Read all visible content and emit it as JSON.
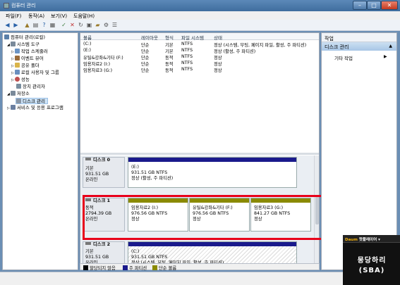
{
  "window": {
    "title": "컴퓨터 관리"
  },
  "menu": [
    "파일(F)",
    "동작(A)",
    "보기(V)",
    "도움말(H)"
  ],
  "tree": {
    "items": [
      {
        "label": "컴퓨터 관리(로컬)",
        "icon": "computer-icon",
        "color": "#5a7fa8"
      },
      {
        "label": "시스템 도구",
        "icon": "tools-icon",
        "color": "#7a8a9a"
      },
      {
        "label": "작업 스케줄러",
        "icon": "clock-icon",
        "color": "#6b94c4"
      },
      {
        "label": "이벤트 뷰어",
        "icon": "event-icon",
        "color": "#9a6b3a"
      },
      {
        "label": "공유 폴더",
        "icon": "folder-icon",
        "color": "#d9b44a"
      },
      {
        "label": "로컬 사용자 및 그룹",
        "icon": "users-icon",
        "color": "#6a8fbf"
      },
      {
        "label": "성능",
        "icon": "performance-icon",
        "color": "#c05050"
      },
      {
        "label": "장치 관리자",
        "icon": "device-icon",
        "color": "#7a8fa0"
      },
      {
        "label": "저장소",
        "icon": "storage-icon",
        "color": "#7a8a9a"
      },
      {
        "label": "디스크 관리",
        "icon": "disk-icon",
        "color": "#8895a5"
      },
      {
        "label": "서비스 및 응용 프로그램",
        "icon": "services-icon",
        "color": "#6a7fa0"
      }
    ]
  },
  "volumes": {
    "headers": [
      "볼륨",
      "레이아웃",
      "형식",
      "파일 시스템",
      "상태"
    ],
    "rows": [
      [
        "(C:)",
        "단순",
        "기본",
        "NTFS",
        "정상 (시스템, 부팅, 페이지 파일, 활성, 주 파티션)"
      ],
      [
        "(E:)",
        "단순",
        "기본",
        "NTFS",
        "정상 (활성, 주 파티션)"
      ],
      [
        "유틸&강좌&기타 (F:)",
        "단순",
        "동적",
        "NTFS",
        "정상"
      ],
      [
        "임용자료2 (I:)",
        "단순",
        "동적",
        "NTFS",
        "정상"
      ],
      [
        "임용자료3 (G:)",
        "단순",
        "동적",
        "NTFS",
        "정상"
      ]
    ]
  },
  "disks": [
    {
      "name": "디스크 0",
      "type": "기본",
      "size": "931.51 GB",
      "status": "온라인",
      "partitions": [
        {
          "label": "(E:)",
          "detail": "931.51 GB NTFS",
          "status": "정상 (활성, 주 파티션)"
        }
      ]
    },
    {
      "name": "디스크 1",
      "type": "동적",
      "size": "2794.39 GB",
      "status": "온라인",
      "partitions": [
        {
          "label": "임용자료2  (I:)",
          "detail": "976.56 GB NTFS",
          "status": "정상"
        },
        {
          "label": "유틸&강좌&기타  (F:)",
          "detail": "976.56 GB NTFS",
          "status": "정상"
        },
        {
          "label": "임용자료3  (G:)",
          "detail": "841.27 GB NTFS",
          "status": "정상"
        }
      ]
    },
    {
      "name": "디스크 2",
      "type": "기본",
      "size": "931.51 GB",
      "status": "온라인",
      "partitions": [
        {
          "label": "(C:)",
          "detail": "931.51 GB NTFS",
          "status": "정상 (시스템, 부팅, 페이지 파일, 활성, 주 파티션)"
        }
      ]
    }
  ],
  "legend": [
    {
      "label": "할당되지 않음",
      "color": "#000000"
    },
    {
      "label": "주 파티션",
      "color": "#1a1a8c"
    },
    {
      "label": "단순 볼륨",
      "color": "#8a8a00"
    }
  ],
  "actions": {
    "header": "작업",
    "section": "디스크 관리",
    "item": "기타 작업"
  },
  "overlay": {
    "brand_prefix": "Daum",
    "brand_name": "팟플레이어",
    "logo_text": "몽당하리 (SBA)"
  },
  "colors": {
    "primary_partition": "#1a1a8c",
    "simple_volume": "#8a8a00",
    "highlight": "#e8001a"
  }
}
